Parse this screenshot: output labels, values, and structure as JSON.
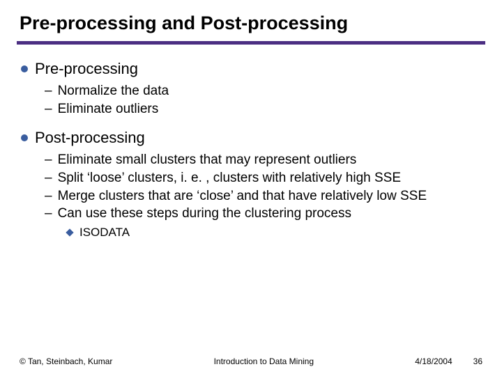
{
  "title": "Pre-processing and Post-processing",
  "sections": [
    {
      "heading": "Pre-processing",
      "items": [
        "Normalize the data",
        "Eliminate outliers"
      ]
    },
    {
      "heading": "Post-processing",
      "items": [
        "Eliminate small clusters that may represent outliers",
        "Split ‘loose’ clusters, i. e. , clusters with relatively high SSE",
        "Merge clusters that are ‘close’ and that have relatively low SSE",
        "Can use these steps during the clustering process"
      ],
      "subsub": "ISODATA"
    }
  ],
  "footer": {
    "copyright": "© Tan, Steinbach, Kumar",
    "subject": "Introduction to Data Mining",
    "date": "4/18/2004",
    "page": "36"
  }
}
